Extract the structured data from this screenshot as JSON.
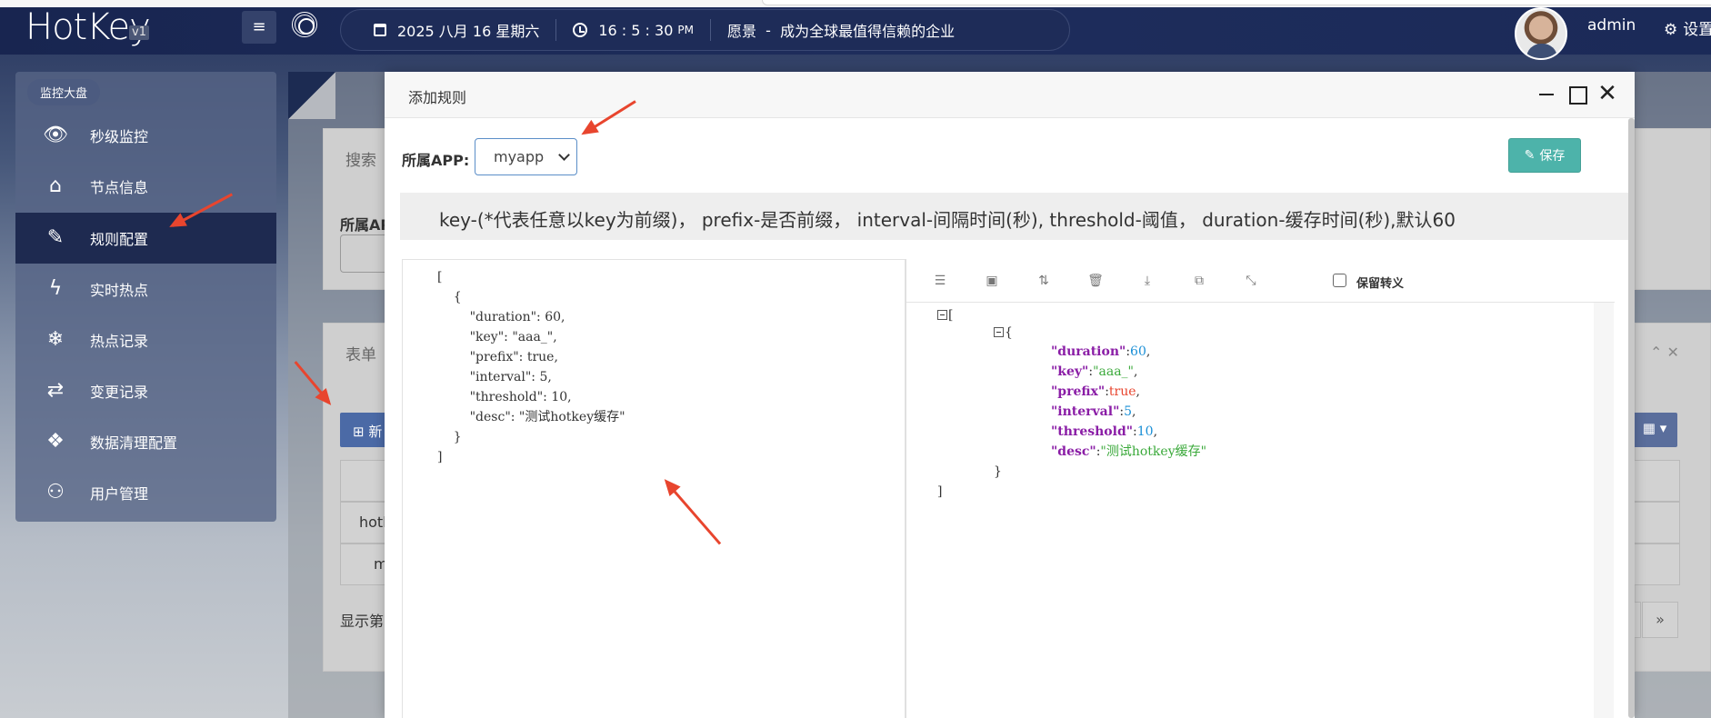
{
  "app": {
    "logo": "HotKey",
    "version": "v1",
    "date": "2025 八月 16 星期六",
    "time": "16 : 5 : 30",
    "time_suffix": "PM",
    "vision_label": "愿景",
    "vision_text": "成为全球最值得信赖的企业",
    "user": "admin",
    "settings_label": "设置"
  },
  "sidebar": {
    "heading": "监控大盘",
    "items": [
      {
        "label": "秒级监控",
        "icon": "eye-icon"
      },
      {
        "label": "节点信息",
        "icon": "home-icon"
      },
      {
        "label": "规则配置",
        "icon": "magic-wand-icon",
        "active": true
      },
      {
        "label": "实时热点",
        "icon": "bolt-icon"
      },
      {
        "label": "热点记录",
        "icon": "snowflake-icon"
      },
      {
        "label": "变更记录",
        "icon": "retweet-icon"
      },
      {
        "label": "数据清理配置",
        "icon": "cubes-icon"
      },
      {
        "label": "用户管理",
        "icon": "user-icon"
      }
    ]
  },
  "background": {
    "search_title": "搜索",
    "app_label": "所属AP",
    "table_title": "表单",
    "new_button": "新",
    "row1": "hotk",
    "row2": "m",
    "footer": "显示第",
    "pager_next": "»"
  },
  "modal": {
    "title": "添加规则",
    "app_label": "所属APP:",
    "app_value": "myapp",
    "save_label": "保存",
    "hint": "key-(*代表任意以key为前缀)， prefix-是否前缀， interval-间隔时间(秒), threshold-阈值， duration-缓存时间(秒),默认60",
    "editor_text": "[\n    {\n        \"duration\": 60,\n        \"key\": \"aaa_\",\n        \"prefix\": true,\n        \"interval\": 5,\n        \"threshold\": 10,\n        \"desc\": \"测试hotkey缓存\"\n    }\n]",
    "preserve_escape_label": "保留转义",
    "json_view": {
      "open_bracket": "[",
      "open_brace": "{",
      "close_brace": "}",
      "close_bracket": "]",
      "fields": [
        {
          "key": "\"duration\"",
          "value": "60",
          "type": "number"
        },
        {
          "key": "\"key\"",
          "value": "\"aaa_\"",
          "type": "string"
        },
        {
          "key": "\"prefix\"",
          "value": "true",
          "type": "boolean"
        },
        {
          "key": "\"interval\"",
          "value": "5",
          "type": "number"
        },
        {
          "key": "\"threshold\"",
          "value": "10",
          "type": "number"
        },
        {
          "key": "\"desc\"",
          "value": "\"测试hotkey缓存\"",
          "type": "string"
        }
      ]
    }
  },
  "colors": {
    "topbar": "#1e2d5c",
    "sidebar_active": "#1e2a50",
    "save_button": "#4db3aa",
    "json_key": "#8a1da6",
    "json_number": "#1a8fd6",
    "json_boolean": "#e8452e",
    "json_string": "#3aa93a",
    "annotation_arrow": "#e8452e"
  }
}
